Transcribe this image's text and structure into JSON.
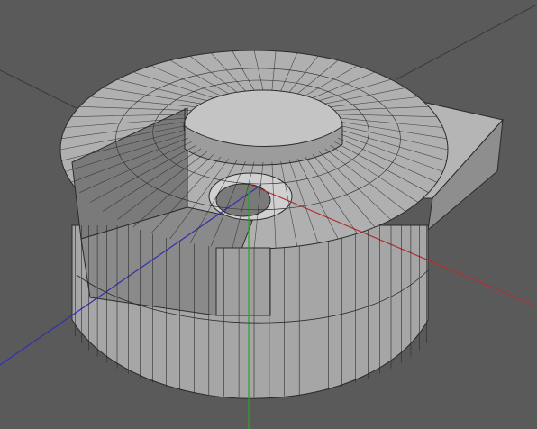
{
  "viewport": {
    "background": "#5a5a5a",
    "mesh_fill": "#a9a9a9",
    "mesh_shadow": "#6e6e6e",
    "edge_color": "#2b2b2b"
  },
  "axes": {
    "x": {
      "color": "#b03030"
    },
    "y": {
      "color": "#30a030"
    },
    "z": {
      "color": "#3030b0"
    },
    "grid_color": "#3a3a3a"
  },
  "model": {
    "name": "",
    "segments": 56
  }
}
